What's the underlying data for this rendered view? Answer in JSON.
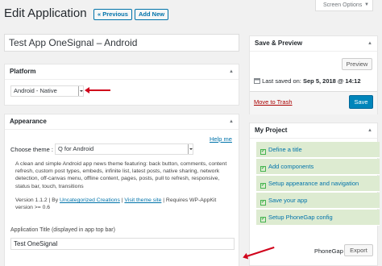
{
  "header": {
    "title": "Edit Application",
    "prev_label": "« Previous",
    "add_new_label": "Add New",
    "screen_options_label": "Screen Options",
    "screen_options_arrow": "▼"
  },
  "post": {
    "title_value": "Test App OneSignal – Android"
  },
  "platform": {
    "heading": "Platform",
    "toggle": "▲",
    "selected": "Android - Native"
  },
  "appearance": {
    "heading": "Appearance",
    "toggle": "▲",
    "help_label": "Help me",
    "theme_label": "Choose theme :",
    "theme_selected": "Q for Android",
    "description": "A clean and simple Android app news theme featuring: back button, comments, content refresh, custom post types, embeds, infinite list, latest posts, native sharing, network detection, off-canvas menu, offline content, pages, posts, pull to refresh, responsive, status bar, touch, transitions",
    "version_prefix": "Version 1.1.2 | By",
    "author_link": "Uncategorized Creations",
    "separator": "|",
    "site_link": "Visit theme site",
    "requirement": "| Requires WP-AppKit version >= 0.6",
    "app_title_label": "Application Title (displayed in app top bar)",
    "app_title_value": "Test OneSignal"
  },
  "save_preview": {
    "heading": "Save & Preview",
    "toggle": "▲",
    "preview_label": "Preview",
    "last_saved_prefix": "Last saved on:",
    "last_saved_value": "Sep 5, 2018 @ 14:12",
    "trash_label": "Move to Trash",
    "save_label": "Save"
  },
  "project": {
    "heading": "My Project",
    "toggle": "▲",
    "items": [
      {
        "label": "Define a title"
      },
      {
        "label": "Add components"
      },
      {
        "label": "Setup appearance and navigation"
      },
      {
        "label": "Save your app"
      },
      {
        "label": "Setup PhoneGap config"
      }
    ],
    "phonegap_label": "PhoneGap Build",
    "export_label": "Export"
  },
  "colors": {
    "accent": "#0073aa",
    "primary_button": "#0085ba",
    "checklist_bg": "#ddebd1",
    "check_green": "#46b450",
    "annotation_arrow": "#d0021b",
    "trash_red": "#a00"
  },
  "icons": {
    "check": "✔",
    "calendar": "calendar-icon"
  }
}
